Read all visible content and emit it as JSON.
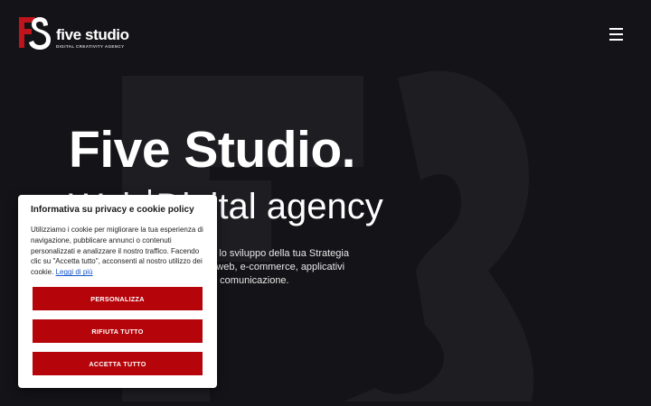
{
  "header": {
    "logo": {
      "name": "five studio",
      "tagline": "DIGITAL CREATIVITY AGENCY"
    }
  },
  "hero": {
    "title": "Five Studio.",
    "subtitle_prefix": "Web",
    "subtitle_suffix": "Digital agency",
    "description_lines": [
      "do per lo sviluppo della tua Strategia",
      "o di siti web, e-commerce, applicativi",
      "e comunicazione."
    ]
  },
  "cookie_banner": {
    "title": "Informativa su privacy e cookie policy",
    "text": "Utilizziamo i cookie per migliorare la tua esperienza di navigazione, pubblicare annunci o contenuti personalizzati e analizzare il nostro traffico. Facendo clic su \"Accetta tutto\", acconsenti al nostro utilizzo dei cookie.",
    "link": "Leggi di più",
    "buttons": {
      "customize": "PERSONALIZZA",
      "reject": "RIFIUTA TUTTO",
      "accept": "ACCETTA TUTTO"
    }
  },
  "colors": {
    "background": "#141418",
    "accent": "#b5040a",
    "logo_red": "#c0141c",
    "link": "#1556c7"
  },
  "icons": {
    "menu": "hamburger-menu-icon",
    "logo": "fs-logo-icon"
  }
}
